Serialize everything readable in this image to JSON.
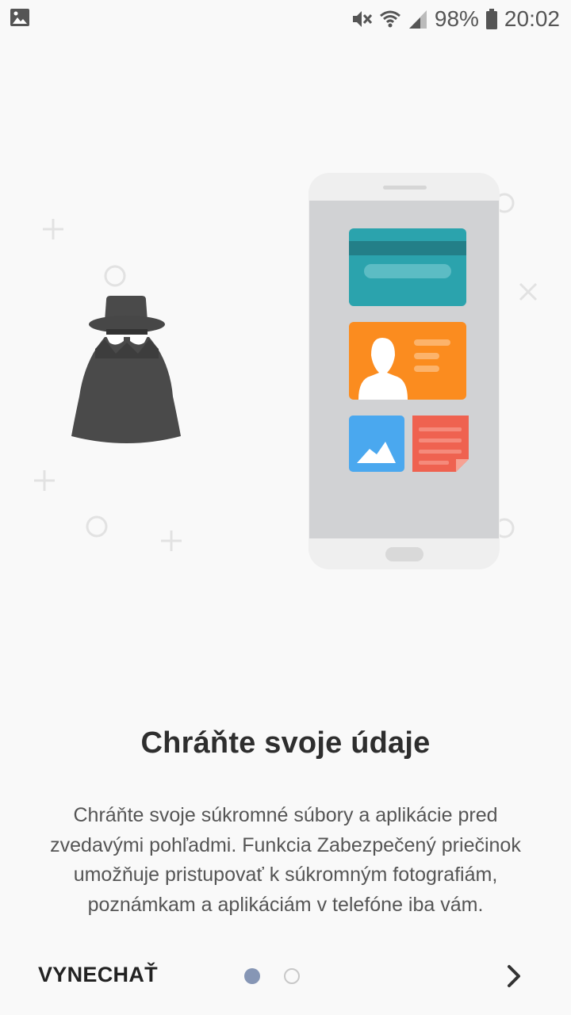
{
  "status_bar": {
    "battery_percent": "98%",
    "time": "20:02",
    "icons": [
      "gallery-notification-icon",
      "mute-icon",
      "wifi-icon",
      "signal-icon",
      "battery-icon"
    ]
  },
  "illustration": {
    "icons": [
      "spy-icon",
      "phone-icon",
      "credit-card-icon",
      "contact-card-icon",
      "image-icon",
      "note-icon"
    ],
    "colors": {
      "card_teal": "#2ba3ad",
      "contact_orange": "#fb8c1f",
      "image_blue": "#4aa8ef",
      "note_red": "#ef6250"
    }
  },
  "onboarding": {
    "title": "Chráňte svoje údaje",
    "description": "Chráňte svoje súkromné súbory a aplikácie pred zvedavými pohľadmi. Funkcia Zabezpečený priečinok umožňuje pristupovať k súkromným fotografiám, poznámkam a aplikáciám v telefóne iba vám."
  },
  "navigation": {
    "skip_label": "VYNECHAŤ",
    "page_count": 2,
    "current_page": 1
  },
  "colors": {
    "accent_dot": "#8696b5",
    "background": "#f9f9f9"
  }
}
